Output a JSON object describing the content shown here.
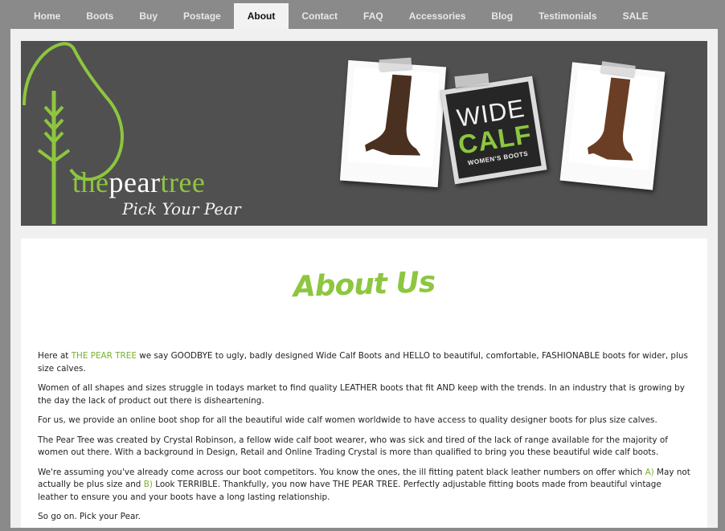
{
  "nav": {
    "items": [
      "Home",
      "Boots",
      "Buy",
      "Postage",
      "About",
      "Contact",
      "FAQ",
      "Accessories",
      "Blog",
      "Testimonials",
      "SALE"
    ],
    "active": "About"
  },
  "banner": {
    "logo": {
      "the": "the",
      "pear": "pear",
      "tree": "tree",
      "tagline": "Pick Your Pear"
    },
    "sign": {
      "line1": "WIDE",
      "line2": "CALF",
      "line3": "WOMEN'S BOOTS"
    }
  },
  "content": {
    "title": "About Us",
    "p1": {
      "pre": "Here at ",
      "brand": "THE PEAR TREE",
      "post": " we say GOODBYE to ugly, badly designed Wide Calf Boots and HELLO to beautiful, comfortable, FASHIONABLE boots for wider, plus size calves."
    },
    "p2": "Women of all shapes and sizes struggle in todays market to find quality LEATHER boots that fit AND keep with the trends. In an industry that is growing by the day the lack of product out there is disheartening.",
    "p3": "For us, we provide an online boot shop for all the beautiful wide calf women worldwide to have access to quality designer boots for plus size calves.",
    "p4": "The Pear Tree was created by Crystal Robinson, a fellow wide calf boot wearer, who was sick and tired of the lack of range available for the majority of women out there. With a background in Design, Retail and Online Trading Crystal is more than qualified to bring you these beautiful wide calf boots.",
    "p5": {
      "a": "We're assuming you've already come across our boot competitors. You know the ones, the ill fitting patent black leather numbers on offer which ",
      "labelA": "A)",
      "b": " May not actually be plus size and ",
      "labelB": "B)",
      "c": " Look TERRIBLE. Thankfully, you now have THE PEAR TREE. Perfectly adjustable fitting boots made from beautiful vintage leather to ensure you and your boots have a long lasting relationship."
    },
    "p6": "So go on. Pick your Pear."
  },
  "colors": {
    "accent": "#8dc63f",
    "banner_bg": "#505050",
    "page_bg": "#8a8a8a"
  }
}
